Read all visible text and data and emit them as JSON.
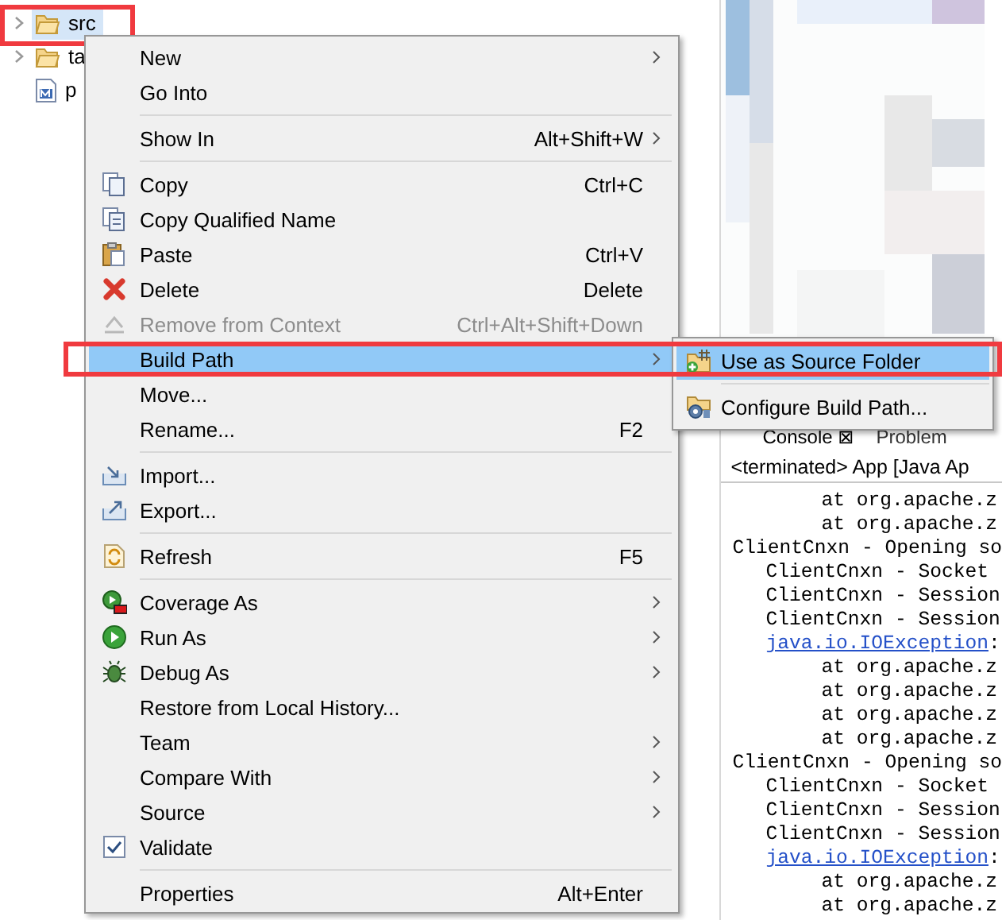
{
  "tree": {
    "items": [
      {
        "label": "src",
        "kind": "folder",
        "selected": true,
        "framed": true
      },
      {
        "label": "ta",
        "kind": "folder",
        "selected": false,
        "framed": false
      },
      {
        "label": "p",
        "kind": "pom",
        "selected": false,
        "framed": false
      }
    ]
  },
  "console": {
    "tabs": [
      {
        "label": "Console ⊠",
        "selected": true
      },
      {
        "label": "Problem",
        "selected": false
      }
    ],
    "title": "<terminated> App [Java Ap",
    "lines": [
      {
        "kind": "frame",
        "text": "at org.apache.z"
      },
      {
        "kind": "frame",
        "text": "at org.apache.z"
      },
      {
        "kind": "entry",
        "text": "ClientCnxn - Opening so"
      },
      {
        "kind": "detail",
        "text": "ClientCnxn - Socket"
      },
      {
        "kind": "detail",
        "text": "ClientCnxn - Session"
      },
      {
        "kind": "detail",
        "text": "ClientCnxn - Session"
      },
      {
        "kind": "exception",
        "text": "java.io.IOException",
        "suffix": ":"
      },
      {
        "kind": "frame",
        "text": "at org.apache.z"
      },
      {
        "kind": "frame",
        "text": "at org.apache.z"
      },
      {
        "kind": "frame",
        "text": "at org.apache.z"
      },
      {
        "kind": "frame",
        "text": "at org.apache.z"
      },
      {
        "kind": "entry",
        "text": "ClientCnxn - Opening so"
      },
      {
        "kind": "detail",
        "text": "ClientCnxn - Socket"
      },
      {
        "kind": "detail",
        "text": "ClientCnxn - Session"
      },
      {
        "kind": "detail",
        "text": "ClientCnxn - Session"
      },
      {
        "kind": "exception",
        "text": "java.io.IOException",
        "suffix": ":"
      },
      {
        "kind": "frame",
        "text": "at org.apache.z"
      },
      {
        "kind": "frame",
        "text": "at org.apache.z"
      }
    ]
  },
  "context_menu": {
    "sections": [
      {
        "items": [
          {
            "label": "New",
            "kind": "none",
            "submenu": true,
            "disabled": false,
            "selected": false,
            "framed": false
          },
          {
            "label": "Go Into",
            "kind": "none",
            "submenu": false,
            "disabled": false,
            "selected": false,
            "framed": false
          }
        ]
      },
      {
        "items": [
          {
            "label": "Show In",
            "shortcut": "Alt+Shift+W",
            "kind": "none",
            "submenu": true,
            "disabled": false,
            "selected": false,
            "framed": false
          }
        ]
      },
      {
        "items": [
          {
            "label": "Copy",
            "shortcut": "Ctrl+C",
            "kind": "copy",
            "submenu": false,
            "disabled": false,
            "selected": false,
            "framed": false
          },
          {
            "label": "Copy Qualified Name",
            "kind": "copy-name",
            "submenu": false,
            "disabled": false,
            "selected": false,
            "framed": false
          },
          {
            "label": "Paste",
            "shortcut": "Ctrl+V",
            "kind": "paste",
            "submenu": false,
            "disabled": false,
            "selected": false,
            "framed": false
          },
          {
            "label": "Delete",
            "shortcut": "Delete",
            "kind": "delete",
            "submenu": false,
            "disabled": false,
            "selected": false,
            "framed": false
          },
          {
            "label": "Remove from Context",
            "shortcut": "Ctrl+Alt+Shift+Down",
            "kind": "remove",
            "submenu": false,
            "disabled": true,
            "selected": false,
            "framed": false
          },
          {
            "label": "Build Path",
            "kind": "none",
            "submenu": true,
            "disabled": false,
            "selected": true,
            "framed": true
          },
          {
            "label": "Move...",
            "kind": "none",
            "submenu": false,
            "disabled": false,
            "selected": false,
            "framed": false
          },
          {
            "label": "Rename...",
            "shortcut": "F2",
            "kind": "none",
            "submenu": false,
            "disabled": false,
            "selected": false,
            "framed": false
          }
        ]
      },
      {
        "items": [
          {
            "label": "Import...",
            "kind": "import",
            "submenu": false,
            "disabled": false,
            "selected": false,
            "framed": false
          },
          {
            "label": "Export...",
            "kind": "export",
            "submenu": false,
            "disabled": false,
            "selected": false,
            "framed": false
          }
        ]
      },
      {
        "items": [
          {
            "label": "Refresh",
            "shortcut": "F5",
            "kind": "refresh",
            "submenu": false,
            "disabled": false,
            "selected": false,
            "framed": false
          }
        ]
      },
      {
        "items": [
          {
            "label": "Coverage As",
            "kind": "coverage",
            "submenu": true,
            "disabled": false,
            "selected": false,
            "framed": false
          },
          {
            "label": "Run As",
            "kind": "run",
            "submenu": true,
            "disabled": false,
            "selected": false,
            "framed": false
          },
          {
            "label": "Debug As",
            "kind": "debug",
            "submenu": true,
            "disabled": false,
            "selected": false,
            "framed": false
          },
          {
            "label": "Restore from Local History...",
            "kind": "none",
            "submenu": false,
            "disabled": false,
            "selected": false,
            "framed": false
          },
          {
            "label": "Team",
            "kind": "none",
            "submenu": true,
            "disabled": false,
            "selected": false,
            "framed": false
          },
          {
            "label": "Compare With",
            "kind": "none",
            "submenu": true,
            "disabled": false,
            "selected": false,
            "framed": false
          },
          {
            "label": "Source",
            "kind": "none",
            "submenu": true,
            "disabled": false,
            "selected": false,
            "framed": false
          },
          {
            "label": "Validate",
            "kind": "validate",
            "submenu": false,
            "disabled": false,
            "selected": false,
            "framed": false
          }
        ]
      },
      {
        "items": [
          {
            "label": "Properties",
            "shortcut": "Alt+Enter",
            "kind": "none",
            "submenu": false,
            "disabled": false,
            "selected": false,
            "framed": false
          }
        ]
      }
    ]
  },
  "submenu": {
    "items": [
      {
        "label": "Use as Source Folder",
        "kind": "source-folder",
        "selected": true
      },
      {
        "label": "Configure Build Path...",
        "kind": "configure",
        "selected": false
      }
    ]
  }
}
